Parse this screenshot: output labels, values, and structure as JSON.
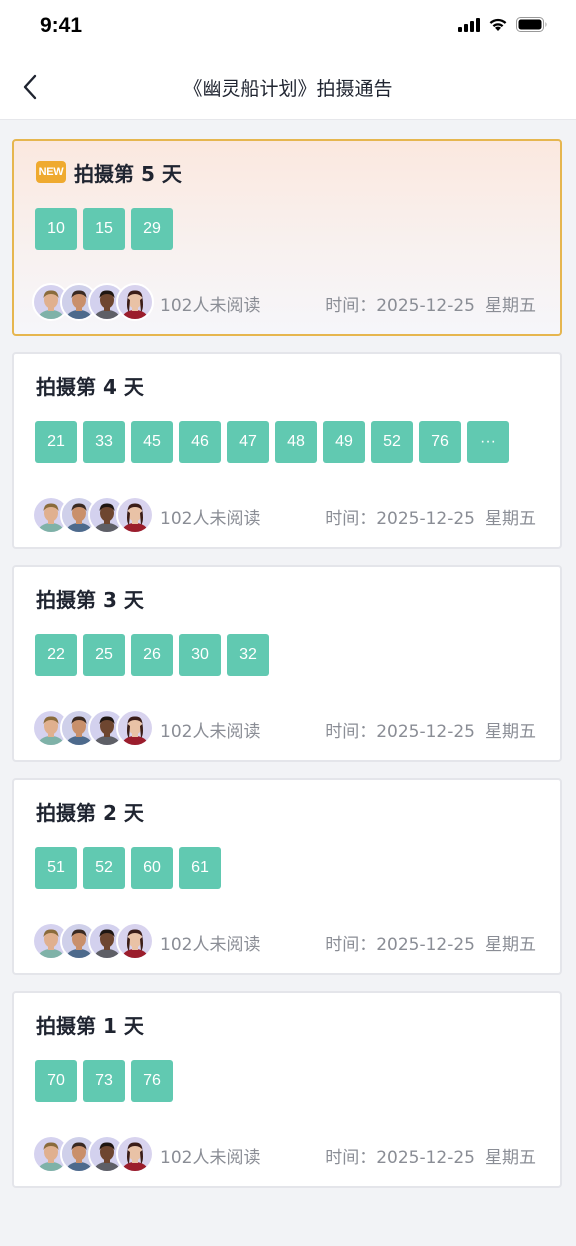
{
  "status_bar": {
    "time": "9:41",
    "icons": [
      "signal-icon",
      "wifi-icon",
      "battery-icon"
    ]
  },
  "nav": {
    "back_icon": "chevron-left-icon",
    "title": "《幽灵船计划》拍摄通告"
  },
  "colors": {
    "chip": "#61c9b1",
    "new_border": "#e6b64f",
    "new_badge": "#efaa2f",
    "page_bg": "#f2f3f6"
  },
  "cards": [
    {
      "is_new": true,
      "badge": "NEW",
      "title": "拍摄第 5 天",
      "chips": [
        "10",
        "15",
        "29"
      ],
      "unread": "102人未阅读",
      "time_label": "时间：",
      "date": "2025-12-25",
      "weekday": "星期五"
    },
    {
      "is_new": false,
      "title": "拍摄第 4 天",
      "chips": [
        "21",
        "33",
        "45",
        "46",
        "47",
        "48",
        "49",
        "52",
        "76",
        "···"
      ],
      "unread": "102人未阅读",
      "time_label": "时间：",
      "date": "2025-12-25",
      "weekday": "星期五"
    },
    {
      "is_new": false,
      "title": "拍摄第 3 天",
      "chips": [
        "22",
        "25",
        "26",
        "30",
        "32"
      ],
      "unread": "102人未阅读",
      "time_label": "时间：",
      "date": "2025-12-25",
      "weekday": "星期五"
    },
    {
      "is_new": false,
      "title": "拍摄第 2 天",
      "chips": [
        "51",
        "52",
        "60",
        "61"
      ],
      "unread": "102人未阅读",
      "time_label": "时间：",
      "date": "2025-12-25",
      "weekday": "星期五"
    },
    {
      "is_new": false,
      "title": "拍摄第 1 天",
      "chips": [
        "70",
        "73",
        "76"
      ],
      "unread": "102人未阅读",
      "time_label": "时间：",
      "date": "2025-12-25",
      "weekday": "星期五"
    }
  ]
}
